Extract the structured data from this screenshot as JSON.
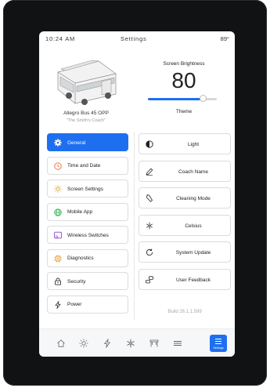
{
  "status": {
    "time": "10:24 AM",
    "title": "Settings",
    "temp": "89°"
  },
  "coach": {
    "name": "Allegro Bus 45 OPP",
    "subtitle": "\"The Smith's Coach\""
  },
  "brightness": {
    "label": "Screen Brightness",
    "value": "80",
    "level": 0.8
  },
  "theme": {
    "label": "Theme"
  },
  "nav": [
    {
      "label": "General",
      "icon": "gear-icon",
      "active": true
    },
    {
      "label": "Time and Date",
      "icon": "clock-icon"
    },
    {
      "label": "Screen Settings",
      "icon": "sun-icon"
    },
    {
      "label": "Mobile App",
      "icon": "globe-icon"
    },
    {
      "label": "Wireless Switches",
      "icon": "cast-icon"
    },
    {
      "label": "Diagnostics",
      "icon": "chip-icon"
    },
    {
      "label": "Security",
      "icon": "lock-icon"
    },
    {
      "label": "Power",
      "icon": "lightning-icon"
    }
  ],
  "settings": [
    {
      "label": "Light",
      "icon": "contrast-icon"
    },
    {
      "label": "Coach Name",
      "icon": "pencil-icon"
    },
    {
      "label": "Cleaning Mode",
      "icon": "spray-icon"
    },
    {
      "label": "Celsius",
      "icon": "snowflake-icon"
    },
    {
      "label": "System Update",
      "icon": "refresh-icon"
    },
    {
      "label": "User Feedback",
      "icon": "chat-icon"
    }
  ],
  "build": "Build 26.1.1.599",
  "tabs": [
    {
      "icon": "home-icon"
    },
    {
      "icon": "sun-icon"
    },
    {
      "icon": "lightning-icon"
    },
    {
      "icon": "snowflake-icon"
    },
    {
      "icon": "awning-icon"
    },
    {
      "icon": "menu-icon"
    },
    {
      "icon": "settings-menu-icon",
      "label": "Settings",
      "active": true
    }
  ],
  "colors": {
    "accent": "#1e6ff0",
    "bezel": "#111214"
  }
}
